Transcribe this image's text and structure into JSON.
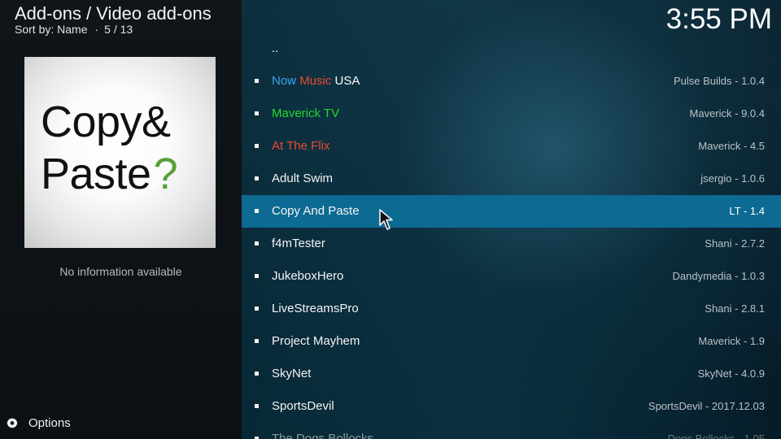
{
  "header": {
    "breadcrumb": "Add-ons / Video add-ons",
    "sort_label": "Sort by: Name",
    "separator": "·",
    "position": "5 / 13",
    "clock": "3:55 PM"
  },
  "poster": {
    "line1": "Copy&",
    "line2_main": "Paste",
    "line2_mark": "?",
    "accent_color": "#57a036"
  },
  "left_panel": {
    "info_text": "No information available",
    "options_label": "Options",
    "options_icon": "gear-icon"
  },
  "list": {
    "selected_index": 5,
    "items": [
      {
        "label": "..",
        "meta": ""
      },
      {
        "label_parts": [
          {
            "text": "Now ",
            "color": "#3aa5ef"
          },
          {
            "text": "Music",
            "color": "#ec4a2d"
          },
          {
            "text": " USA",
            "color": "#ffffff"
          }
        ],
        "meta": "Pulse Builds - 1.0.4"
      },
      {
        "label_parts": [
          {
            "text": "Maverick TV",
            "color": "#21d92b"
          }
        ],
        "meta": "Maverick - 9.0.4"
      },
      {
        "label_parts": [
          {
            "text": "At The Flix",
            "color": "#ec4a2d"
          }
        ],
        "meta": "Maverick - 4.5"
      },
      {
        "label": "Adult Swim",
        "meta": "jsergio - 1.0.6"
      },
      {
        "label": "Copy And Paste",
        "meta": "LT - 1.4"
      },
      {
        "label": "f4mTester",
        "meta": "Shani - 2.7.2"
      },
      {
        "label": "JukeboxHero",
        "meta": "Dandymedia - 1.0.3"
      },
      {
        "label": "LiveStreamsPro",
        "meta": "Shani - 2.8.1"
      },
      {
        "label": "Project Mayhem",
        "meta": "Maverick - 1.9"
      },
      {
        "label": "SkyNet",
        "meta": "SkyNet - 4.0.9"
      },
      {
        "label": "SportsDevil",
        "meta": "SportsDevil - 2017.12.03"
      },
      {
        "label": "The Dogs Bollocks",
        "meta": "Dogs Bollocks - 1.05"
      }
    ]
  },
  "colors": {
    "selected_row": "#0d6a92",
    "left_background": "#101519",
    "right_background": "#0b3446"
  }
}
